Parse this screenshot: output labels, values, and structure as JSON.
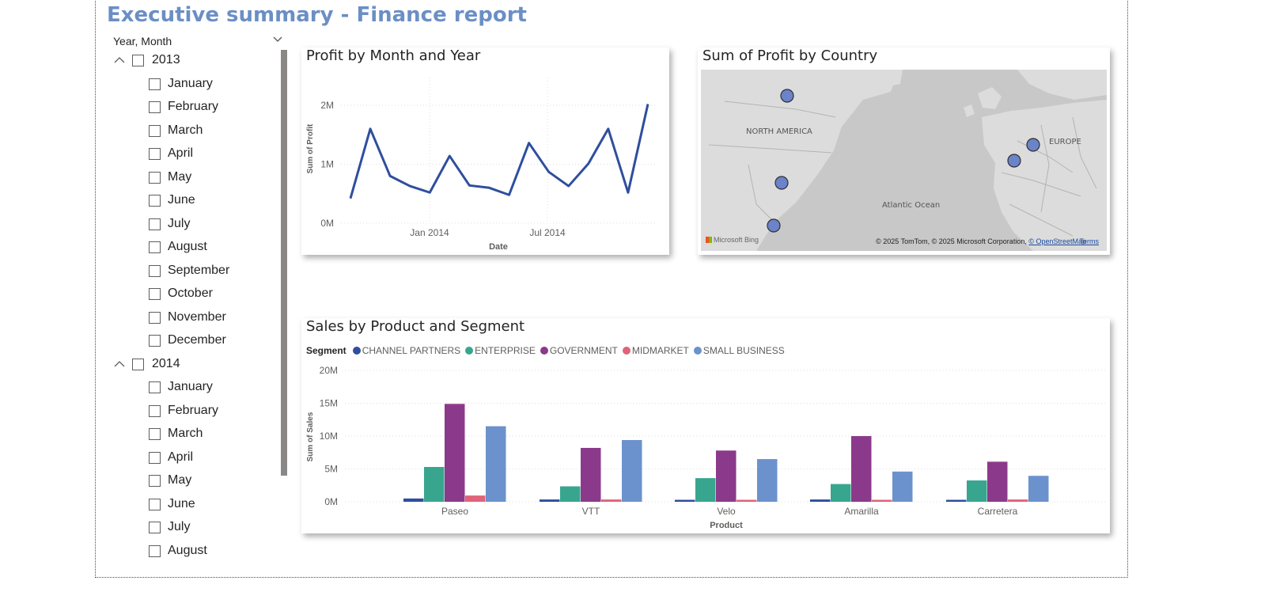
{
  "report": {
    "title": "Executive summary - Finance report"
  },
  "slicer": {
    "header": "Year, Month",
    "years": [
      {
        "label": "2013",
        "months": [
          "January",
          "February",
          "March",
          "April",
          "May",
          "June",
          "July",
          "August",
          "September",
          "October",
          "November",
          "December"
        ]
      },
      {
        "label": "2014",
        "months": [
          "January",
          "February",
          "March",
          "April",
          "May",
          "June",
          "July",
          "August"
        ]
      }
    ]
  },
  "visuals": {
    "profit_by_month": {
      "title": "Profit by Month and Year",
      "chart_data": {
        "type": "line",
        "title": "Profit by Month and Year",
        "xlabel": "Date",
        "ylabel": "Sum of Profit",
        "x_tick_labels": [
          "Jan 2014",
          "Jul 2014"
        ],
        "y_tick_labels": [
          "2M",
          "1M",
          "0M"
        ],
        "ylim": [
          0,
          2000000
        ],
        "grid": true,
        "color": "#2f4e9e",
        "series": [
          {
            "x": [
              "2013-09",
              "2013-10",
              "2013-11",
              "2013-12",
              "2014-01",
              "2014-02",
              "2014-03",
              "2014-04",
              "2014-05",
              "2014-06",
              "2014-07",
              "2014-08",
              "2014-09",
              "2014-10",
              "2014-11",
              "2014-12"
            ],
            "values": [
              420000,
              1600000,
              800000,
              630000,
              520000,
              1140000,
              640000,
              600000,
              480000,
              1360000,
              870000,
              630000,
              1010000,
              1600000,
              520000,
              2020000
            ]
          }
        ]
      }
    },
    "profit_by_country": {
      "title": "Sum of Profit by Country",
      "labels": {
        "north_america": "NORTH AMERICA",
        "europe": "EUROPE",
        "ocean": "Atlantic Ocean"
      },
      "bing": "Microsoft Bing",
      "attribution": {
        "text": "© 2025 TomTom, © 2025 Microsoft Corporation, ",
        "osm": "© OpenStreetMap",
        "terms": "Terms"
      },
      "bubble_color": "#6b83c9",
      "bubbles": [
        "Canada",
        "United States of America",
        "Mexico",
        "France",
        "Germany"
      ]
    },
    "sales_by_product": {
      "title": "Sales by Product and Segment",
      "legend_title": "Segment",
      "chart_data": {
        "type": "bar",
        "title": "Sales by Product and Segment",
        "xlabel": "Product",
        "ylabel": "Sum of Sales",
        "ylim": [
          0,
          20000000
        ],
        "y_tick_labels": [
          "20M",
          "15M",
          "10M",
          "5M",
          "0M"
        ],
        "grid": true,
        "legend_position": "top-left",
        "categories": [
          "Paseo",
          "VTT",
          "Velo",
          "Amarilla",
          "Carretera"
        ],
        "series": [
          {
            "name": "CHANNEL PARTNERS",
            "color": "#2f4e9e",
            "values": [
              500000,
              350000,
              300000,
              350000,
              300000
            ]
          },
          {
            "name": "ENTERPRISE",
            "color": "#38a68e",
            "values": [
              5300000,
              2350000,
              3600000,
              2700000,
              3250000
            ]
          },
          {
            "name": "GOVERNMENT",
            "color": "#8b3a8b",
            "values": [
              14900000,
              8200000,
              7800000,
              10000000,
              6100000
            ]
          },
          {
            "name": "MIDMARKET",
            "color": "#e0637a",
            "values": [
              950000,
              350000,
              300000,
              300000,
              350000
            ]
          },
          {
            "name": "SMALL BUSINESS",
            "color": "#6b92cc",
            "values": [
              11500000,
              9400000,
              6500000,
              4600000,
              3950000
            ]
          }
        ]
      }
    }
  }
}
